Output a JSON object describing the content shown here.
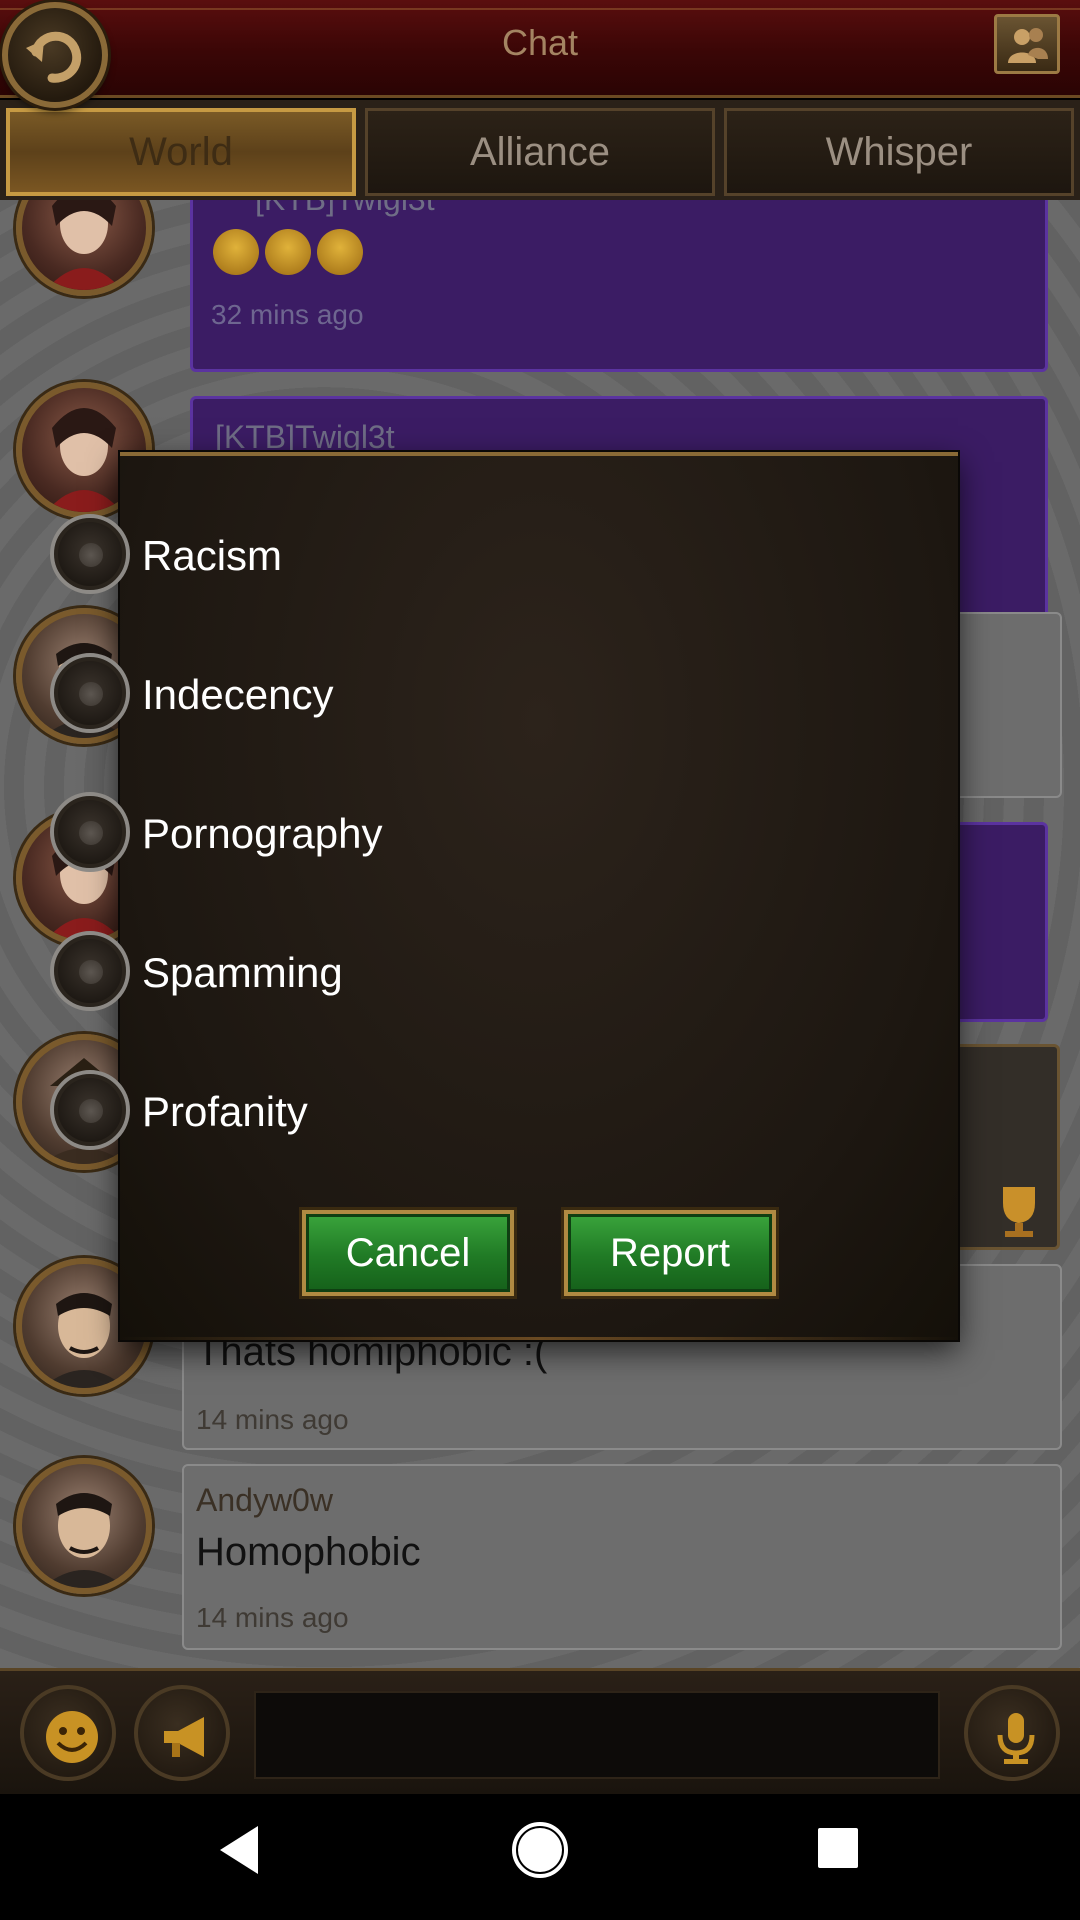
{
  "header": {
    "title": "Chat"
  },
  "tabs": [
    {
      "label": "World",
      "active": true
    },
    {
      "label": "Alliance",
      "active": false
    },
    {
      "label": "Whisper",
      "active": false
    }
  ],
  "messages": [
    {
      "name": "[KTB]Twigl3t",
      "text": "😂😂😂",
      "time": "32 mins ago"
    },
    {
      "name": "[KTB]Twigl3t",
      "text": "",
      "time": ""
    },
    {
      "name": "",
      "text": "Thats homiphobic :(",
      "time": "14 mins ago"
    },
    {
      "name": "Andyw0w",
      "text": "Homophobic",
      "time": "14 mins ago"
    }
  ],
  "report_dialog": {
    "options": [
      "Racism",
      "Indecency",
      "Pornography",
      "Spamming",
      "Profanity"
    ],
    "cancel_label": "Cancel",
    "report_label": "Report"
  },
  "colors": {
    "accent_gold": "#c69a43",
    "purple_bubble": "#3b1c64",
    "button_green": "#207a25",
    "header_red": "#5a0e0e"
  },
  "icons": {
    "back": "back-arrow-icon",
    "friends": "friends-icon",
    "emoji": "smiley-icon",
    "horn": "megaphone-icon",
    "mic": "microphone-icon"
  }
}
